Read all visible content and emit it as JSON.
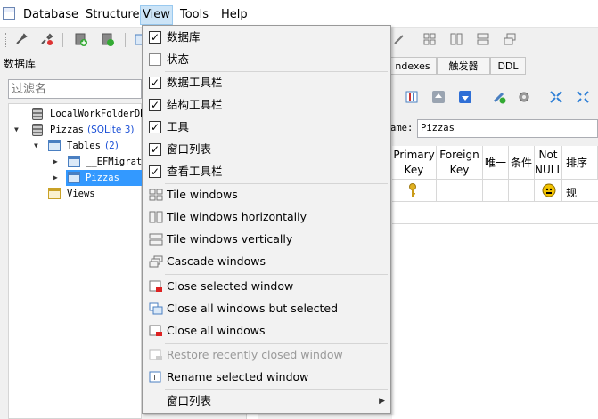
{
  "menubar": {
    "items": [
      {
        "label": "Database"
      },
      {
        "label": "Structure"
      },
      {
        "label": "View"
      },
      {
        "label": "Tools"
      },
      {
        "label": "Help"
      }
    ]
  },
  "left_panel": {
    "title": "数据库",
    "filter_placeholder": "过滤名",
    "tree": [
      {
        "label": "LocalWorkFolderDB"
      },
      {
        "label": "Pizzas",
        "tag": "(SQLite 3)"
      },
      {
        "label": "Tables",
        "count": "(2)"
      },
      {
        "label": "__EFMigrat"
      },
      {
        "label": "Pizzas"
      },
      {
        "label": "Views"
      }
    ]
  },
  "right_panel": {
    "tabs": [
      {
        "label": "ndexes"
      },
      {
        "label": "触发器"
      },
      {
        "label": "DDL"
      }
    ],
    "name_label": "ame:",
    "name_value": "Pizzas",
    "columns": [
      {
        "line1": "Primary",
        "line2": "Key"
      },
      {
        "line1": "Foreign",
        "line2": "Key"
      },
      {
        "line1": "唯一",
        "line2": ""
      },
      {
        "line1": "条件",
        "line2": ""
      },
      {
        "line1": "Not",
        "line2": "NULL"
      },
      {
        "line1": "排序规",
        "line2": ""
      }
    ]
  },
  "view_menu": {
    "items": [
      {
        "label": "数据库",
        "checked": true
      },
      {
        "label": "状态",
        "checked": false
      },
      {
        "label": "数据工具栏",
        "checked": true
      },
      {
        "label": "结构工具栏",
        "checked": true
      },
      {
        "label": "工具",
        "checked": true
      },
      {
        "label": "窗口列表",
        "checked": true
      },
      {
        "label": "查看工具栏",
        "checked": true
      },
      {
        "label": "Tile windows",
        "icon": "tile-icon"
      },
      {
        "label": "Tile windows horizontally",
        "icon": "tile-horizontal-icon"
      },
      {
        "label": "Tile windows vertically",
        "icon": "tile-vertical-icon"
      },
      {
        "label": "Cascade windows",
        "icon": "cascade-icon"
      },
      {
        "label": "Close selected window",
        "icon": "close-window-icon"
      },
      {
        "label": "Close all windows but selected",
        "icon": "close-others-icon"
      },
      {
        "label": "Close all windows",
        "icon": "close-all-icon"
      },
      {
        "label": "Restore recently closed window",
        "icon": "restore-window-icon",
        "disabled": true
      },
      {
        "label": "Rename selected window",
        "icon": "rename-window-icon"
      },
      {
        "label": "窗口列表",
        "submenu": true
      }
    ]
  },
  "colors": {
    "accent": "#3399ff",
    "menu_highlight": "#cce4f7",
    "link_blue": "#1a4fd6"
  }
}
